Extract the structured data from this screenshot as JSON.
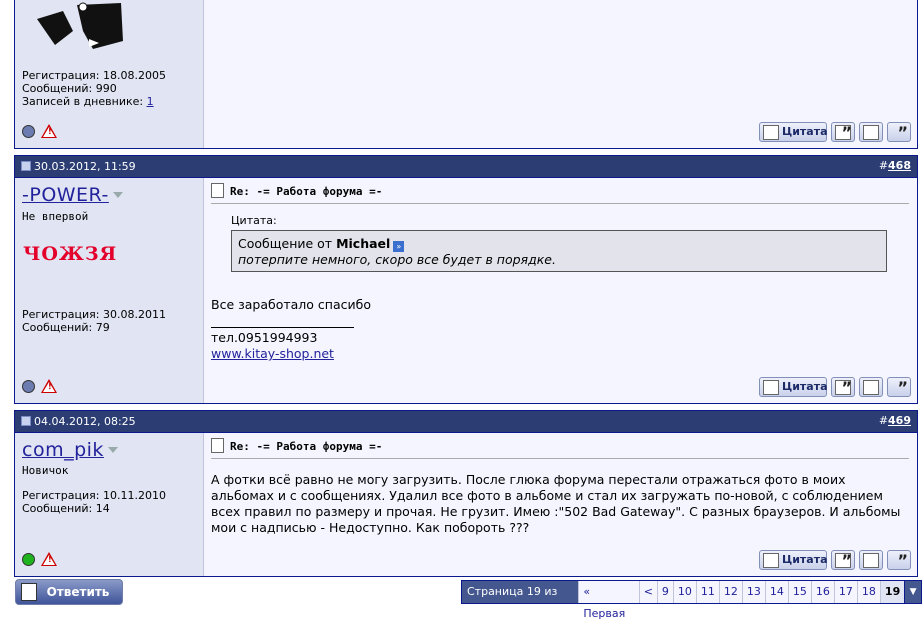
{
  "post_top": {
    "registration": "Регистрация: 18.08.2005",
    "messages": "Сообщений: 990",
    "diary_label": "Записей в дневнике: ",
    "diary_count": "1"
  },
  "post468": {
    "date": "30.03.2012, 11:59",
    "number": "468",
    "username": "-POWER-",
    "user_title": "Не впервой",
    "avatar_text": "ЧОЖЗЯ",
    "registration": "Регистрация: 30.08.2011",
    "messages": "Сообщений: 79",
    "title": "Re: -= Работа форума =-",
    "quote_label": "Цитата:",
    "quote_from": "Сообщение от",
    "quote_author": "Michael",
    "quote_text": "потерпите немного, скоро все будет в порядке.",
    "text": "Все заработало спасибо",
    "sig_phone": "тел.0951994993",
    "sig_link": "www.kitay-shop.net"
  },
  "post469": {
    "date": "04.04.2012, 08:25",
    "number": "469",
    "username": "com_pik",
    "user_title": "Новичок",
    "registration": "Регистрация: 10.11.2010",
    "messages": "Сообщений: 14",
    "title": "Re: -= Работа форума =-",
    "text": "А фотки всё равно не могу загрузить. После глюка форума перестали отражаться фото в моих альбомах и с сообщениях. Удалил все фото в альбоме и стал их загружать по-новой, с соблюдением всех правил по размеру и прочая. Не грузит. Имею :\"502 Bad Gateway\". С разных браузеров. И альбомы мои с надписью - Недоступно. Как побороть ???"
  },
  "buttons": {
    "quote": "Цитата",
    "reply": "Ответить"
  },
  "pager": {
    "label": "Страница 19 из 19",
    "first": "« Первая",
    "prev": "<",
    "pages": [
      "9",
      "10",
      "11",
      "12",
      "13",
      "14",
      "15",
      "16",
      "17",
      "18"
    ],
    "current": "19"
  },
  "colors": {
    "header_bg": "#2b3d72",
    "left_bg": "#e1e4f2",
    "link": "#22229c",
    "online": "#1fb41f",
    "offline": "#6d7cb0"
  }
}
